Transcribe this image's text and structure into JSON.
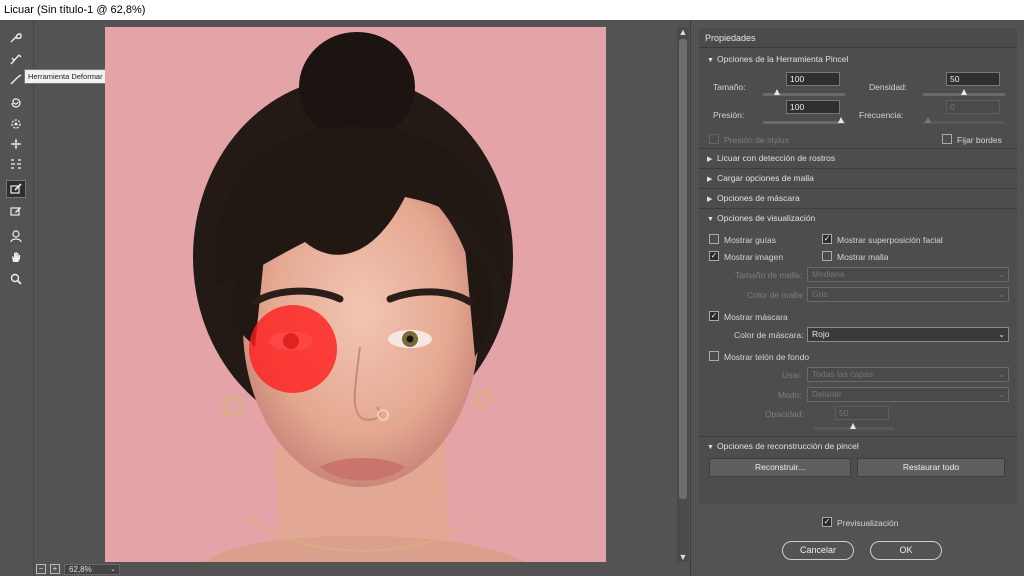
{
  "window": {
    "title": "Licuar (Sin título-1 @ 62,8%)"
  },
  "toolbar": {
    "tooltip": "Herramienta Deformar hacia adelante (W)",
    "tools": [
      {
        "name": "forward-warp-icon",
        "active": false
      },
      {
        "name": "reconstruct-icon",
        "active": false
      },
      {
        "name": "smooth-icon",
        "active": false
      },
      {
        "name": "twirl-icon",
        "active": false
      },
      {
        "name": "pucker-icon",
        "active": false
      },
      {
        "name": "bloat-icon",
        "active": false
      },
      {
        "name": "push-left-icon",
        "active": false
      },
      {
        "name": "freeze-mask-icon",
        "active": true
      },
      {
        "name": "thaw-mask-icon",
        "active": false
      },
      {
        "name": "face-tool-icon",
        "active": false
      },
      {
        "name": "hand-icon",
        "active": false
      },
      {
        "name": "zoom-icon",
        "active": false
      }
    ]
  },
  "zoom": {
    "minus": "−",
    "plus": "+",
    "value": "62,8%"
  },
  "panel": {
    "title": "Propiedades",
    "brush": {
      "header": "Opciones de la Herramienta Pincel",
      "size_label": "Tamaño:",
      "size_value": "100",
      "density_label": "Densidad:",
      "density_value": "50",
      "pressure_label": "Presión:",
      "pressure_value": "100",
      "rate_label": "Frecuencia:",
      "rate_value": "0",
      "stylus_label": "Presión de stylus",
      "pin_label": "Fijar bordes"
    },
    "sections": {
      "face": "Licuar con detección de rostros",
      "mesh": "Cargar opciones de malla",
      "mask": "Opciones de máscara",
      "view": "Opciones de visualización",
      "reconstruct": "Opciones de reconstrucción de pincel"
    },
    "view": {
      "show_guides": "Mostrar guías",
      "show_face_overlay": "Mostrar superposición facial",
      "show_image": "Mostrar imagen",
      "show_mesh": "Mostrar malla",
      "mesh_size_label": "Tamaño de malla:",
      "mesh_size_value": "Mediana",
      "mesh_color_label": "Color de malla:",
      "mesh_color_value": "Gris",
      "show_mask": "Mostrar máscara",
      "mask_color_label": "Color de máscara:",
      "mask_color_value": "Rojo",
      "show_backdrop": "Mostrar telón de fondo",
      "use_label": "Usar:",
      "use_value": "Todas las capas",
      "mode_label": "Modo:",
      "mode_value": "Delante",
      "opacity_label": "Opacidad:",
      "opacity_value": "50"
    },
    "reconstruct": {
      "reconstruct_btn": "Reconstruir...",
      "restore_btn": "Restaurar todo"
    },
    "preview_label": "Previsualización",
    "cancel": "Cancelar",
    "ok": "OK"
  },
  "colors": {
    "mask": "#ff2a2a",
    "background": "#e4a3a6",
    "ui": "#535353"
  }
}
